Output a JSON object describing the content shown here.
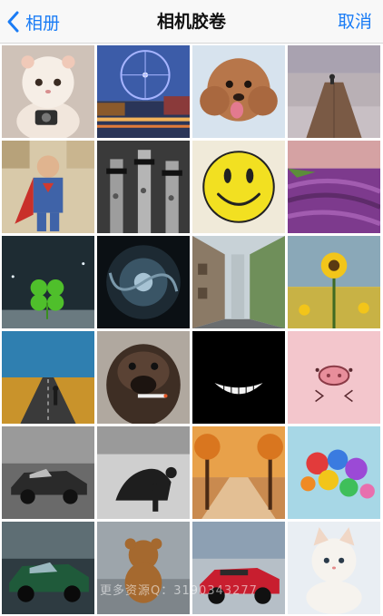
{
  "navbar": {
    "back_label": "相册",
    "title": "相机胶卷",
    "cancel_label": "取消",
    "accent_color": "#1a7cf5"
  },
  "photos": [
    {
      "subject": "cat-with-camera"
    },
    {
      "subject": "ferris-wheel-city-night"
    },
    {
      "subject": "poodle-puppy"
    },
    {
      "subject": "pier-sunset"
    },
    {
      "subject": "comic-superman"
    },
    {
      "subject": "giraffes-sunglasses"
    },
    {
      "subject": "smiley-face"
    },
    {
      "subject": "lavender-field"
    },
    {
      "subject": "four-leaf-clover"
    },
    {
      "subject": "spiral-galaxy"
    },
    {
      "subject": "narrow-street"
    },
    {
      "subject": "sunflower-field"
    },
    {
      "subject": "man-on-road"
    },
    {
      "subject": "dog-with-cigar"
    },
    {
      "subject": "cheshire-grin"
    },
    {
      "subject": "pig-face"
    },
    {
      "subject": "sports-car-bw"
    },
    {
      "subject": "silhouette-cheetah"
    },
    {
      "subject": "autumn-trees"
    },
    {
      "subject": "balloons-sky"
    },
    {
      "subject": "green-sports-car"
    },
    {
      "subject": "teddy-bear"
    },
    {
      "subject": "red-convertible"
    },
    {
      "subject": "white-kitten"
    }
  ],
  "watermark": "更多资源Q：3190343277"
}
